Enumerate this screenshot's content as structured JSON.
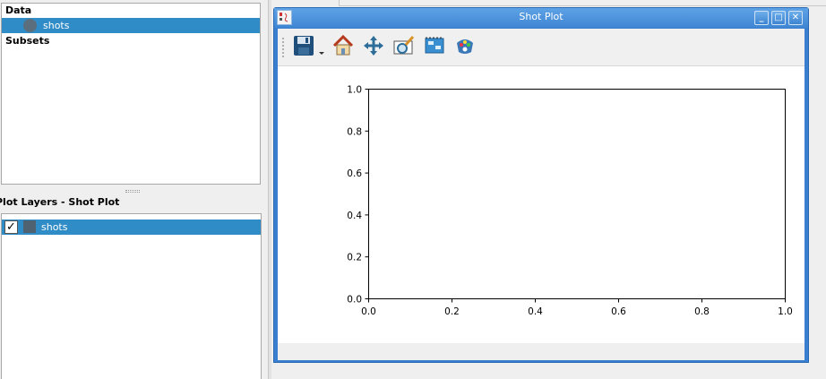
{
  "data_panel": {
    "data_header": "Data",
    "dataset_label": "shots",
    "subsets_header": "Subsets"
  },
  "layers_panel": {
    "title": "Plot Layers - Shot Plot",
    "layer_label": "shots",
    "layer_checked": "✓"
  },
  "window": {
    "title": "Shot Plot",
    "minimize_glyph": "_",
    "maximize_glyph": "□",
    "close_glyph": "✕"
  },
  "toolbar": {
    "icons": [
      "save-icon",
      "home-icon",
      "pan-icon",
      "zoom-icon",
      "subplots-icon",
      "customize-icon"
    ]
  },
  "colors": {
    "selection": "#308cc6",
    "titlebar": "#3f86d3"
  },
  "chart_data": {
    "type": "scatter",
    "series": [],
    "xlim": [
      0.0,
      1.0
    ],
    "ylim": [
      0.0,
      1.0
    ],
    "x_ticks": [
      "0.0",
      "0.2",
      "0.4",
      "0.6",
      "0.8",
      "1.0"
    ],
    "y_ticks": [
      "0.0",
      "0.2",
      "0.4",
      "0.6",
      "0.8",
      "1.0"
    ],
    "title": "",
    "xlabel": "",
    "ylabel": "",
    "grid": false
  }
}
